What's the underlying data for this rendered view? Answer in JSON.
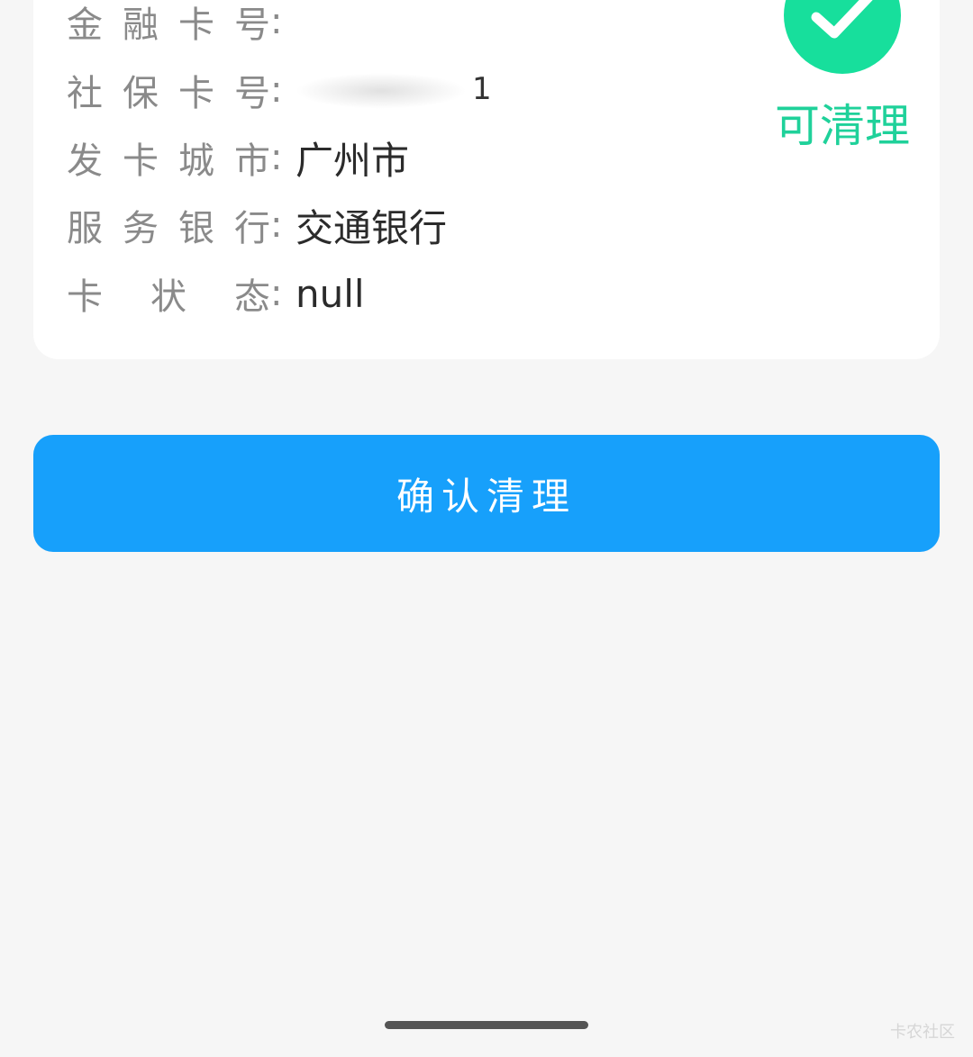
{
  "info": {
    "rows": [
      {
        "label_chars": [
          "金",
          "融",
          "卡",
          "号"
        ],
        "colon": ":",
        "value": ""
      },
      {
        "label_chars": [
          "社",
          "保",
          "卡",
          "号"
        ],
        "colon": ":",
        "value": "1"
      },
      {
        "label_chars": [
          "发",
          "卡",
          "城",
          "市"
        ],
        "colon": ":",
        "value": "广州市"
      },
      {
        "label_chars": [
          "服",
          "务",
          "银",
          "行"
        ],
        "colon": ":",
        "value": "交通银行"
      },
      {
        "label_chars": [
          "卡",
          "状",
          "态"
        ],
        "colon": ":",
        "value": "null"
      }
    ]
  },
  "status": {
    "icon": "check-circle-icon",
    "text": "可清理",
    "color": "#17df9c"
  },
  "actions": {
    "confirm_label": "确认清理",
    "confirm_color": "#17a0fb"
  },
  "watermark": {
    "text": "卡农社区"
  }
}
